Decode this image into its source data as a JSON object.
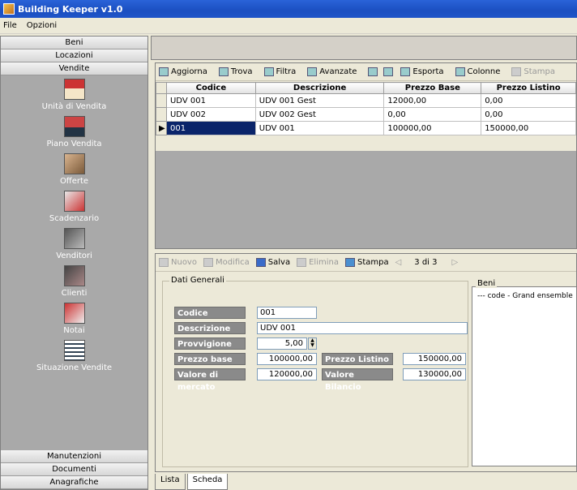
{
  "app": {
    "title": "Building Keeper v1.0"
  },
  "menu": [
    "File",
    "Opzioni"
  ],
  "sidebar": {
    "headers_top": [
      "Beni",
      "Locazioni",
      "Vendite"
    ],
    "items": [
      "Unità di Vendita",
      "Piano Vendita",
      "Offerte",
      "Scadenzario",
      "Venditori",
      "Clienti",
      "Notai",
      "Situazione Vendite"
    ],
    "headers_bottom": [
      "Manutenzioni",
      "Documenti",
      "Anagrafiche"
    ]
  },
  "grid_toolbar": [
    "Aggiorna",
    "Trova",
    "Filtra",
    "Avanzate",
    "Esporta",
    "Colonne",
    "Stampa"
  ],
  "grid": {
    "columns": [
      "Codice",
      "Descrizione",
      "Prezzo Base",
      "Prezzo Listino"
    ],
    "rows": [
      [
        "UDV 001",
        "UDV 001 Gest",
        "12000,00",
        "0,00"
      ],
      [
        "UDV 002",
        "UDV 002 Gest",
        "0,00",
        "0,00"
      ],
      [
        "001",
        "UDV 001",
        "100000,00",
        "150000,00"
      ]
    ]
  },
  "detail_toolbar": {
    "nuovo": "Nuovo",
    "modifica": "Modifica",
    "salva": "Salva",
    "elimina": "Elimina",
    "stampa": "Stampa",
    "position": "3 di 3"
  },
  "form": {
    "legend": "Dati Generali",
    "codice_label": "Codice",
    "codice_value": "001",
    "descrizione_label": "Descrizione",
    "descrizione_value": "UDV 001",
    "provvigione_label": "Provvigione",
    "provvigione_value": "5,00",
    "prezzo_base_label": "Prezzo base",
    "prezzo_base_value": "100000,00",
    "prezzo_listino_label": "Prezzo Listino",
    "prezzo_listino_value": "150000,00",
    "valore_mercato_label": "Valore di mercato",
    "valore_mercato_value": "120000,00",
    "valore_bilancio_label": "Valore Bilancio",
    "valore_bilancio_value": "130000,00"
  },
  "beni": {
    "legend": "Beni",
    "item": "--- code - Grand ensemble"
  },
  "tabs": [
    "Lista",
    "Scheda"
  ]
}
